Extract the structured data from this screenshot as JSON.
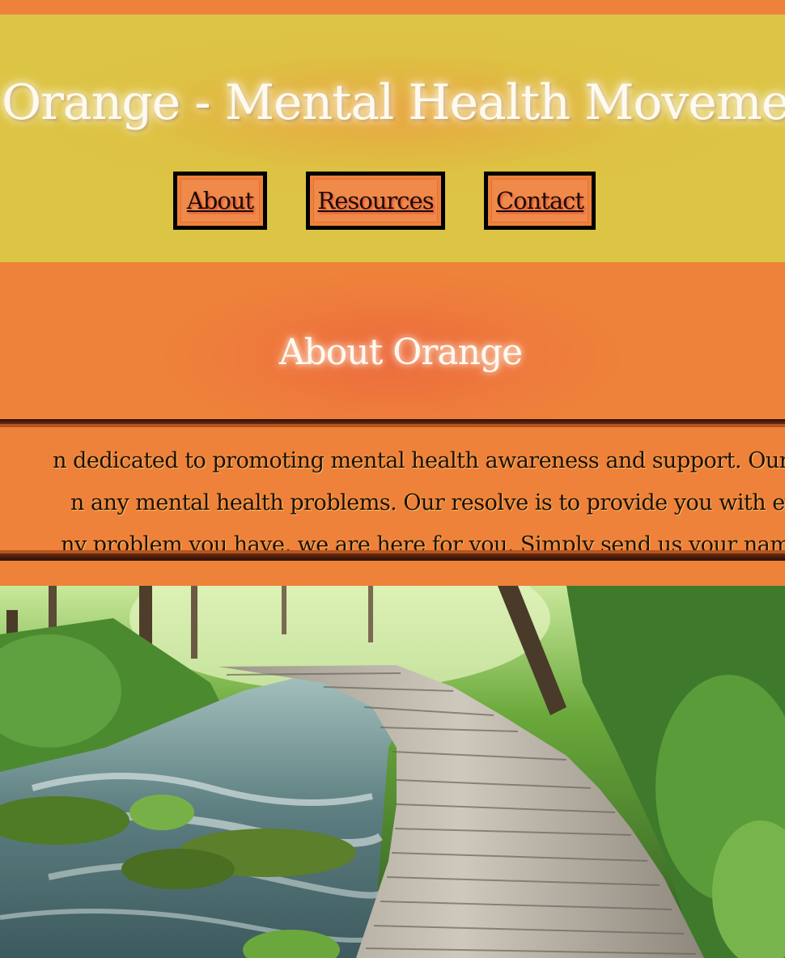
{
  "header": {
    "title": "Orange - Mental Health Movement"
  },
  "nav": {
    "items": [
      {
        "label": "About"
      },
      {
        "label": "Resources"
      },
      {
        "label": "Contact"
      }
    ]
  },
  "about": {
    "heading": "About Orange",
    "lines": [
      "n dedicated to promoting mental health awareness and support. Our p",
      "n any mental health problems. Our resolve is to provide you with eve",
      "ny problem you have, we are here for you. Simply send us your name,"
    ]
  },
  "hero_image": {
    "description": "forest-boardwalk-photo"
  },
  "colors": {
    "page_orange": "#ee823a",
    "header_yellow": "#dcc545",
    "nav_border": "#000000",
    "title_white": "#fffaf0"
  }
}
